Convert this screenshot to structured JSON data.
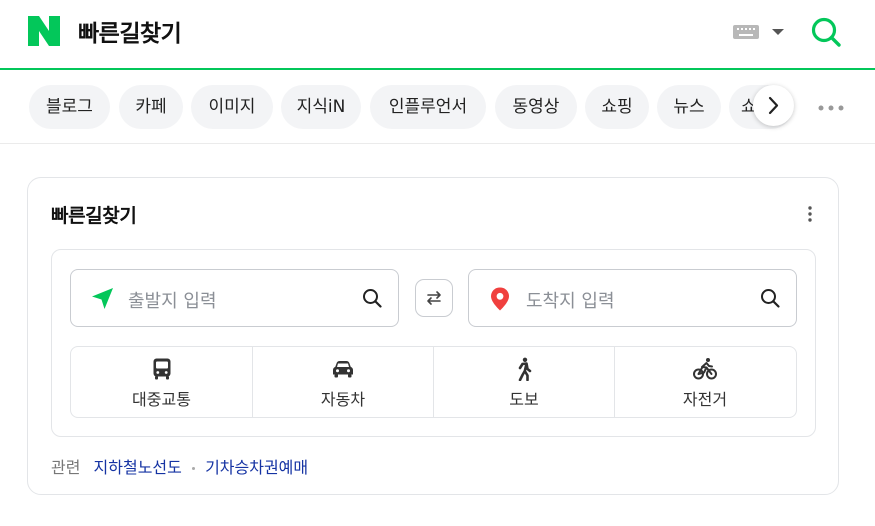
{
  "header": {
    "logo_letter": "N",
    "query": "빠른길찾기",
    "icons": {
      "keyboard": "keyboard-icon",
      "dropdown": "caret-down-icon",
      "search": "search-icon"
    },
    "brand_color": "#03c75a"
  },
  "tabs": {
    "items": [
      {
        "label": "블로그"
      },
      {
        "label": "카페"
      },
      {
        "label": "이미지"
      },
      {
        "label": "지식iN"
      },
      {
        "label": "인플루언서"
      },
      {
        "label": "동영상"
      },
      {
        "label": "쇼핑"
      },
      {
        "label": "뉴스"
      },
      {
        "label": "쇼"
      }
    ],
    "icons": {
      "next": "chevron-right-icon",
      "more": "more-dots-icon"
    }
  },
  "card": {
    "title": "빠른길찾기",
    "menu_icon": "kebab-menu-icon",
    "start": {
      "placeholder": "출발지 입력",
      "icon": "navigation-arrow-icon",
      "color": "#03c75a"
    },
    "end": {
      "placeholder": "도착지 입력",
      "icon": "location-pin-icon",
      "color": "#f0403e"
    },
    "swap_icon": "swap-arrows-icon",
    "modes": [
      {
        "label": "대중교통",
        "icon": "bus-icon"
      },
      {
        "label": "자동차",
        "icon": "car-icon"
      },
      {
        "label": "도보",
        "icon": "walk-icon"
      },
      {
        "label": "자전거",
        "icon": "bicycle-icon"
      }
    ],
    "related": {
      "label": "관련",
      "links": [
        "지하철노선도",
        "기차승차권예매"
      ],
      "link_color": "#1533a3"
    }
  }
}
